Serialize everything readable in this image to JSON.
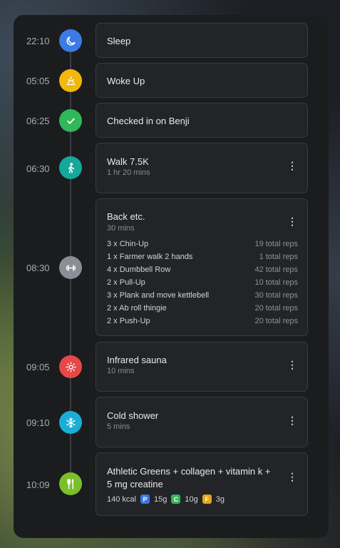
{
  "colors": {
    "sleep": "#3b7be6",
    "wake": "#f2b70c",
    "check": "#2fb85a",
    "walk": "#16a89a",
    "gym": "#8a8e96",
    "sauna": "#e64848",
    "cold": "#1aaed6",
    "food": "#7bbf2a",
    "protein": "#3a78e0",
    "carbs": "#2fb85a",
    "fat": "#e6a21a"
  },
  "events": [
    {
      "time": "22:10",
      "icon": "moon-icon",
      "title": "Sleep"
    },
    {
      "time": "05:05",
      "icon": "sunrise-icon",
      "title": "Woke Up"
    },
    {
      "time": "06:25",
      "icon": "check-icon",
      "title": "Checked in on Benji"
    },
    {
      "time": "06:30",
      "icon": "walk-icon",
      "title": "Walk 7.5K",
      "sub": "1 hr 20 mins"
    },
    {
      "time": "08:30",
      "icon": "dumbbell-icon",
      "title": "Back etc.",
      "sub": "30 mins",
      "exercises": [
        {
          "name": "3 x Chin-Up",
          "reps": "19 total reps"
        },
        {
          "name": "1 x Farmer walk 2 hands",
          "reps": "1 total reps"
        },
        {
          "name": "4 x Dumbbell Row",
          "reps": "42 total reps"
        },
        {
          "name": "2 x Pull-Up",
          "reps": "10 total reps"
        },
        {
          "name": "3 x Plank and move kettlebell",
          "reps": "30 total reps"
        },
        {
          "name": "2 x Ab roll thingie",
          "reps": "20 total reps"
        },
        {
          "name": "2 x Push-Up",
          "reps": "20 total reps"
        }
      ]
    },
    {
      "time": "09:05",
      "icon": "sun-icon",
      "title": "Infrared sauna",
      "sub": "10 mins"
    },
    {
      "time": "09:10",
      "icon": "snowflake-icon",
      "title": "Cold shower",
      "sub": "5 mins"
    },
    {
      "time": "10:09",
      "icon": "utensils-icon",
      "title_line1": "Athletic Greens + collagen + vitamin k +",
      "title_line2": "5 mg creatine",
      "kcal": "140 kcal",
      "p_label": "P",
      "p_value": "15g",
      "c_label": "C",
      "c_value": "10g",
      "f_label": "F",
      "f_value": "3g"
    }
  ],
  "more_glyph": "⋮"
}
